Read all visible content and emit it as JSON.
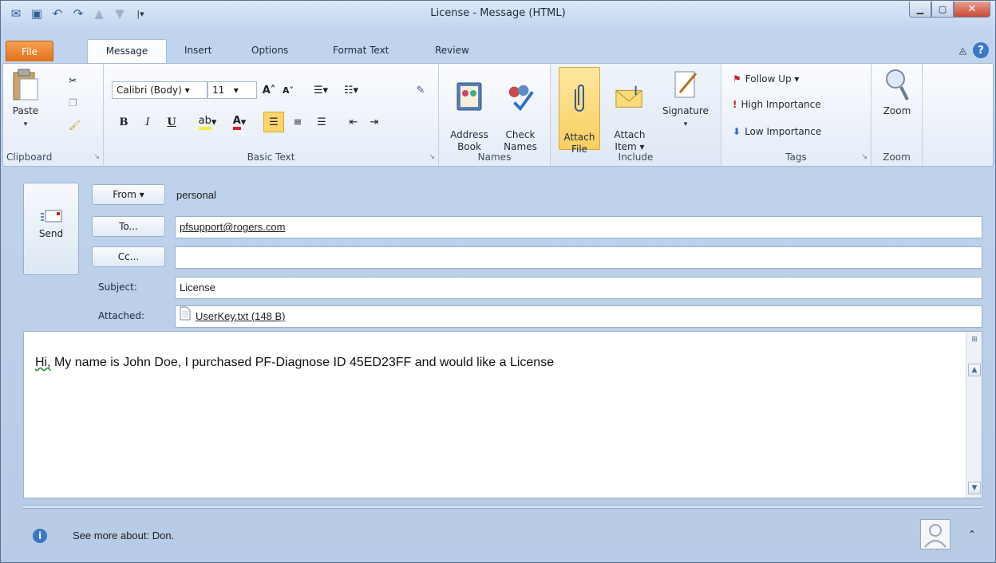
{
  "window": {
    "title": "License - Message (HTML)"
  },
  "tabs": [
    {
      "label": "File"
    },
    {
      "label": "Message"
    },
    {
      "label": "Insert"
    },
    {
      "label": "Options"
    },
    {
      "label": "Format Text"
    },
    {
      "label": "Review"
    }
  ],
  "ribbon": {
    "clipboard": {
      "label": "Clipboard",
      "paste": "Paste"
    },
    "basic_text": {
      "label": "Basic Text",
      "font_name": "Calibri (Body)",
      "font_size": "11",
      "bold": "B",
      "italic": "I",
      "underline": "U"
    },
    "names": {
      "label": "Names",
      "address_book": "Address\nBook",
      "check_names": "Check\nNames"
    },
    "include": {
      "label": "Include",
      "attach_file": "Attach\nFile",
      "attach_item": "Attach\nItem ▾",
      "signature": "Signature"
    },
    "tags": {
      "label": "Tags",
      "follow_up": "Follow Up ▾",
      "high_importance": "High Importance",
      "low_importance": "Low Importance"
    },
    "zoom": {
      "label": "Zoom",
      "zoom_btn": "Zoom"
    }
  },
  "form": {
    "send": "Send",
    "from_btn": "From ▾",
    "from_value": "personal",
    "to_btn": "To...",
    "to_value": "pfsupport@rogers.com",
    "cc_btn": "Cc...",
    "cc_value": "",
    "subject_label": "Subject:",
    "subject_value": "License",
    "attached_label": "Attached:",
    "attachment": "UserKey.txt (148 B)"
  },
  "body": {
    "greeting": "Hi,",
    "text": "  My name is John Doe, I purchased PF-Diagnose ID 45ED23FF and would like a License"
  },
  "people_pane": {
    "see_more": "See more about: Don."
  }
}
